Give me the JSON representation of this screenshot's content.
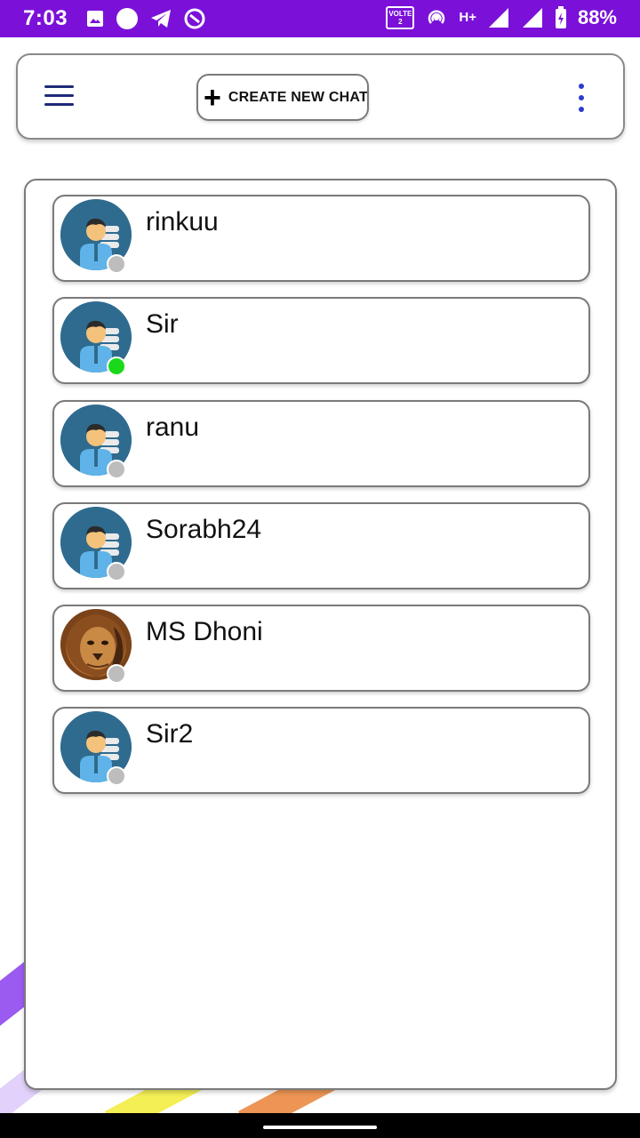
{
  "status_bar": {
    "time": "7:03",
    "volte_top": "VOLTE",
    "volte_bottom": "2",
    "network": "H+",
    "battery_percent": "88%",
    "bg_color": "#7b11d8"
  },
  "toolbar": {
    "create_label": "CREATE NEW CHAT",
    "menu_icon": "hamburger-icon",
    "more_icon": "more-vert-icon",
    "accent_color": "#2b3bd1"
  },
  "chats": [
    {
      "name": "rinkuu",
      "status": "offline",
      "avatar": "person-avatar"
    },
    {
      "name": "Sir",
      "status": "online",
      "avatar": "person-avatar"
    },
    {
      "name": "ranu",
      "status": "offline",
      "avatar": "person-avatar"
    },
    {
      "name": "Sorabh24",
      "status": "offline",
      "avatar": "person-avatar"
    },
    {
      "name": "MS Dhoni",
      "status": "offline",
      "avatar": "lion-photo"
    },
    {
      "name": "Sir2",
      "status": "offline",
      "avatar": "person-avatar"
    }
  ],
  "colors": {
    "online": "#1ad81a",
    "offline": "#bdbdbd",
    "avatar_bg": "#2f6b8e"
  }
}
